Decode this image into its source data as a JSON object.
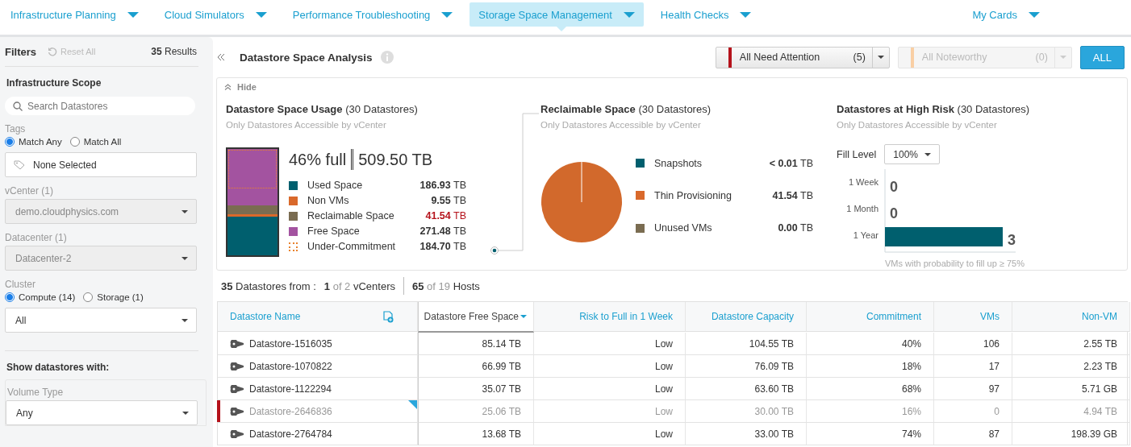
{
  "nav": {
    "items": [
      {
        "label": "Infrastructure Planning",
        "selected": false
      },
      {
        "label": "Cloud Simulators",
        "selected": false
      },
      {
        "label": "Performance Troubleshooting",
        "selected": false
      },
      {
        "label": "Storage Space Management",
        "selected": true
      },
      {
        "label": "Health Checks",
        "selected": false
      }
    ],
    "right_item": {
      "label": "My Cards",
      "selected": false
    }
  },
  "filters": {
    "title": "Filters",
    "reset": "Reset All",
    "results_count": "35",
    "results_label": "Results",
    "scope_title": "Infrastructure Scope",
    "search": {
      "placeholder": "Search Datastores"
    },
    "tags": {
      "label": "Tags",
      "options": [
        {
          "label": "Match Any",
          "selected": true
        },
        {
          "label": "Match All",
          "selected": false
        }
      ],
      "field": "None Selected"
    },
    "selects": [
      {
        "label": "vCenter (1)",
        "value": "demo.cloudphysics.com",
        "disabled": true
      },
      {
        "label": "Datacenter (1)",
        "value": "Datacenter-2",
        "disabled": true
      }
    ],
    "cluster": {
      "label": "Cluster",
      "options": [
        {
          "label": "Compute (14)",
          "selected": true
        },
        {
          "label": "Storage (1)",
          "selected": false
        }
      ],
      "value": "All"
    },
    "show_title": "Show datastores with:",
    "volume_type": {
      "label": "Volume Type",
      "value": "Any"
    }
  },
  "header": {
    "title": "Datastore Space Analysis",
    "attention": [
      {
        "label": "All Need Attention",
        "count": "(5)",
        "color": "#b5121b",
        "disabled": false
      },
      {
        "label": "All Noteworthy",
        "count": "(0)",
        "color": "#f9cfa4",
        "disabled": true
      }
    ],
    "all_button": "ALL"
  },
  "panel": {
    "hide": "Hide",
    "usage": {
      "title": "Datastore Space Usage",
      "count": "(30 Datastores)",
      "subtitle": "Only Datastores Accessible by vCenter",
      "percent": "46% full",
      "total": "509.50 TB",
      "legend": [
        {
          "label": "Used Space",
          "value": "186.93",
          "unit": "TB",
          "color": "#005f6e",
          "kind": "solid",
          "alert": false
        },
        {
          "label": "Non VMs",
          "value": "9.55",
          "unit": "TB",
          "color": "#d9692b",
          "kind": "solid",
          "alert": false
        },
        {
          "label": "Reclaimable Space",
          "value": "41.54",
          "unit": "TB",
          "color": "#7a6c51",
          "kind": "solid",
          "alert": true
        },
        {
          "label": "Free Space",
          "value": "271.48",
          "unit": "TB",
          "color": "#a353a0",
          "kind": "solid",
          "alert": false
        },
        {
          "label": "Under-Commitment",
          "value": "184.70",
          "unit": "TB",
          "color": "#e8822e",
          "kind": "dotted",
          "alert": false
        }
      ]
    },
    "reclaimable": {
      "title": "Reclaimable Space",
      "count": "(30 Datastores)",
      "subtitle": "Only Datastores Accessible by vCenter",
      "legend": [
        {
          "label": "Snapshots",
          "value": "< 0.01",
          "unit": "TB",
          "color": "#005f6e"
        },
        {
          "label": "Thin Provisioning",
          "value": "41.54",
          "unit": "TB",
          "color": "#d9692b"
        },
        {
          "label": "Unused VMs",
          "value": "0.00",
          "unit": "TB",
          "color": "#7a6c51"
        }
      ]
    },
    "risk": {
      "title": "Datastores at High Risk",
      "count": "(30 Datastores)",
      "subtitle": "Only Datastores Accessible by vCenter",
      "fill_label": "Fill Level",
      "fill_value": "100%",
      "chart_data": {
        "type": "bar",
        "orientation": "horizontal",
        "categories": [
          "1 Week",
          "1 Month",
          "1 Year"
        ],
        "values": [
          0,
          0,
          3
        ],
        "data_labels": true,
        "xlabel": "VMs with probability to fill up ≥ 75%"
      }
    }
  },
  "summary": {
    "count": "35",
    "count_label": "Datastores from :",
    "vcenters": "1",
    "vcenters_of": "of 2",
    "vcenters_label": "vCenters",
    "hosts": "65",
    "hosts_of": "of 19",
    "hosts_label": "Hosts"
  },
  "table": {
    "columns": [
      {
        "label": "Datastore Name",
        "sorted": false
      },
      {
        "label": "Datastore Free Space",
        "sorted": true
      },
      {
        "label": "Risk to Full in 1 Week",
        "sorted": false
      },
      {
        "label": "Datastore Capacity",
        "sorted": false
      },
      {
        "label": "Commitment",
        "sorted": false
      },
      {
        "label": "VMs",
        "sorted": false
      },
      {
        "label": "Non-VM",
        "sorted": false
      }
    ],
    "rows": [
      {
        "flagged": false,
        "cells": [
          "Datastore-1516035",
          "85.14 TB",
          "Low",
          "104.55 TB",
          "40%",
          "106",
          "2.55 TB"
        ]
      },
      {
        "flagged": false,
        "cells": [
          "Datastore-1070822",
          "66.99 TB",
          "Low",
          "76.09 TB",
          "18%",
          "17",
          "2.23 TB"
        ]
      },
      {
        "flagged": false,
        "cells": [
          "Datastore-1122294",
          "35.07 TB",
          "Low",
          "63.60 TB",
          "68%",
          "97",
          "5.71 GB"
        ]
      },
      {
        "flagged": true,
        "cells": [
          "Datastore-2646836",
          "25.06 TB",
          "Low",
          "30.00 TB",
          "16%",
          "0",
          "4.94 TB"
        ]
      },
      {
        "flagged": false,
        "cells": [
          "Datastore-2764784",
          "13.68 TB",
          "Low",
          "33.00 TB",
          "74%",
          "87",
          "198.39 GB"
        ]
      }
    ]
  }
}
